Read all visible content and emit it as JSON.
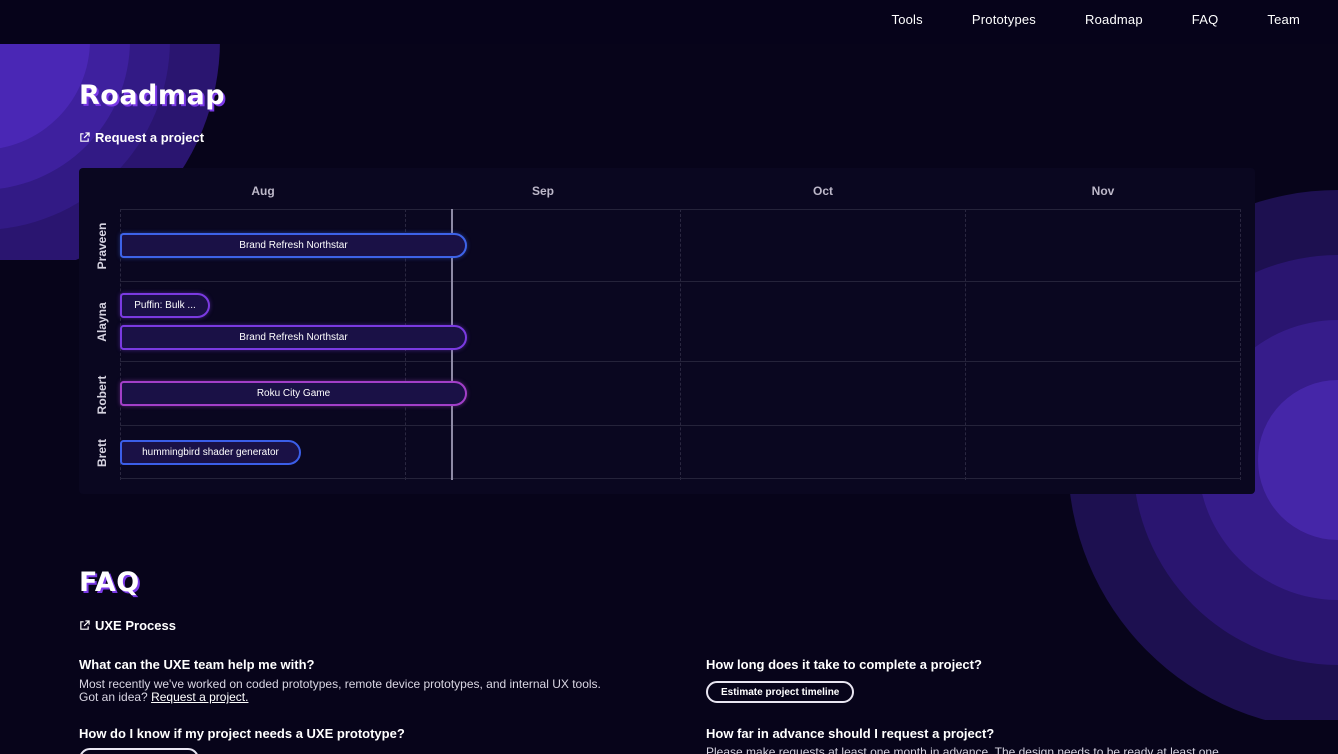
{
  "nav": {
    "items": [
      {
        "label": "Tools"
      },
      {
        "label": "Prototypes"
      },
      {
        "label": "Roadmap"
      },
      {
        "label": "FAQ"
      },
      {
        "label": "Team"
      }
    ]
  },
  "roadmap": {
    "title": "Roadmap",
    "request_link": "Request a project",
    "months": [
      "Aug",
      "Sep",
      "Oct",
      "Nov"
    ],
    "rows": [
      {
        "person": "Praveen",
        "bars": [
          {
            "label": "Brand Refresh Northstar",
            "color": "#3d63e8"
          }
        ]
      },
      {
        "person": "Alayna",
        "bars": [
          {
            "label": "Puffin: Bulk ...",
            "color": "#7a3ae0"
          },
          {
            "label": "Brand Refresh Northstar",
            "color": "#7a3ae0"
          }
        ]
      },
      {
        "person": "Robert",
        "bars": [
          {
            "label": "Roku City Game",
            "color": "#a23fc8"
          }
        ]
      },
      {
        "person": "Brett",
        "bars": [
          {
            "label": "hummingbird shader generator",
            "color": "#3b5ee8"
          }
        ]
      }
    ]
  },
  "faq": {
    "title": "FAQ",
    "process_link": "UXE Process",
    "q1": "What can the UXE team help me with?",
    "a1_line1": "Most recently we've worked on coded prototypes, remote device prototypes, and internal UX tools.",
    "a1_line2_prefix": "Got an idea?",
    "a1_link": "Request a project.",
    "q2": "How do I know if my project needs a UXE prototype?",
    "q3": "How long does it take to complete a project?",
    "q3_button": "Estimate project timeline",
    "q4": "How far in advance should I request a project?",
    "a4_partial": "Please make requests at least one month in advance. The design needs to be ready at least one"
  },
  "colors": {
    "background": "#07041a",
    "accent": "#7a39e6"
  }
}
